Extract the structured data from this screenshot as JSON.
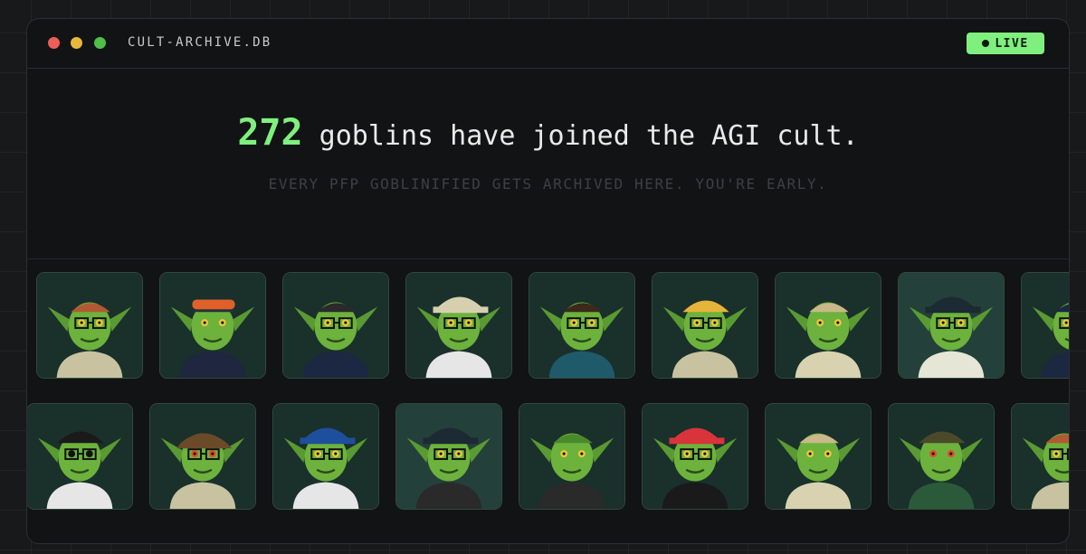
{
  "window": {
    "title": "CULT-ARCHIVE.DB",
    "status_badge": "LIVE"
  },
  "hero": {
    "count": "272",
    "headline_rest": " goblins have joined the AGI cult.",
    "subline": "EVERY PFP GOBLINIFIED GETS ARCHIVED HERE. YOU'RE EARLY."
  },
  "gallery": {
    "rows": [
      [
        {
          "bg": "#1a302b",
          "hair": "#b05a33",
          "hat": "none",
          "shirt": "#c8c2a0",
          "eyes": "#f0c93a",
          "glasses": true
        },
        {
          "bg": "#1a302b",
          "hair": "#263238",
          "hat": "goggles",
          "shirt": "#1e2640",
          "eyes": "#f0c93a",
          "glasses": false
        },
        {
          "bg": "#1a302b",
          "hair": "#2a2a2a",
          "hat": "none",
          "shirt": "#1c2742",
          "eyes": "#f0c93a",
          "glasses": true
        },
        {
          "bg": "#1a302b",
          "hair": "#d6d0b0",
          "hat": "cap",
          "shirt": "#e6e6e6",
          "eyes": "#f0c93a",
          "glasses": true
        },
        {
          "bg": "#1a302b",
          "hair": "#3b2a1a",
          "hat": "none",
          "shirt": "#1f5a6a",
          "eyes": "#f0c93a",
          "glasses": true
        },
        {
          "bg": "#1a302b",
          "hair": "#e6b43a",
          "hat": "beanie",
          "shirt": "#c8c2a0",
          "eyes": "#f0c93a",
          "glasses": true
        },
        {
          "bg": "#1a302b",
          "hair": "#c8b88a",
          "hat": "none",
          "shirt": "#d8d2b0",
          "eyes": "#f0c93a",
          "glasses": false
        },
        {
          "bg": "#24403a",
          "hair": "#1b2a33",
          "hat": "cap",
          "shirt": "#e6e6d6",
          "eyes": "#f0c93a",
          "glasses": true
        },
        {
          "bg": "#1a302b",
          "hair": "#1c2742",
          "hat": "none",
          "shirt": "#1c2742",
          "eyes": "#f0c93a",
          "glasses": true
        }
      ],
      [
        {
          "bg": "#1a302b",
          "hair": "#1a1a1a",
          "hat": "beanie",
          "shirt": "#e6e6e6",
          "eyes": "#111111",
          "glasses": true
        },
        {
          "bg": "#1a302b",
          "hair": "#6b4a2a",
          "hat": "bandana",
          "shirt": "#c8c2a0",
          "eyes": "#e84a2a",
          "glasses": true
        },
        {
          "bg": "#1a302b",
          "hair": "#1e4f9c",
          "hat": "cap",
          "shirt": "#e6e6e6",
          "eyes": "#f0c93a",
          "glasses": true
        },
        {
          "bg": "#24403a",
          "hair": "#1b2a33",
          "hat": "cap",
          "shirt": "#2a2a2a",
          "eyes": "#f0c93a",
          "glasses": true
        },
        {
          "bg": "#1a302b",
          "hair": "#4a8a2a",
          "hat": "none",
          "shirt": "#2a2a2a",
          "eyes": "#f0c93a",
          "glasses": false
        },
        {
          "bg": "#1a302b",
          "hair": "#d8343a",
          "hat": "cap",
          "shirt": "#1a1a1a",
          "eyes": "#f0c93a",
          "glasses": true
        },
        {
          "bg": "#1a302b",
          "hair": "#c8b88a",
          "hat": "none",
          "shirt": "#d8d2b0",
          "eyes": "#f0c93a",
          "glasses": false
        },
        {
          "bg": "#1a302b",
          "hair": "#4a4a2a",
          "hat": "beanie",
          "shirt": "#2a5a3a",
          "eyes": "#e84a2a",
          "glasses": false
        },
        {
          "bg": "#1a302b",
          "hair": "#b05a33",
          "hat": "none",
          "shirt": "#c8c2a0",
          "eyes": "#f0c93a",
          "glasses": true
        }
      ]
    ]
  }
}
